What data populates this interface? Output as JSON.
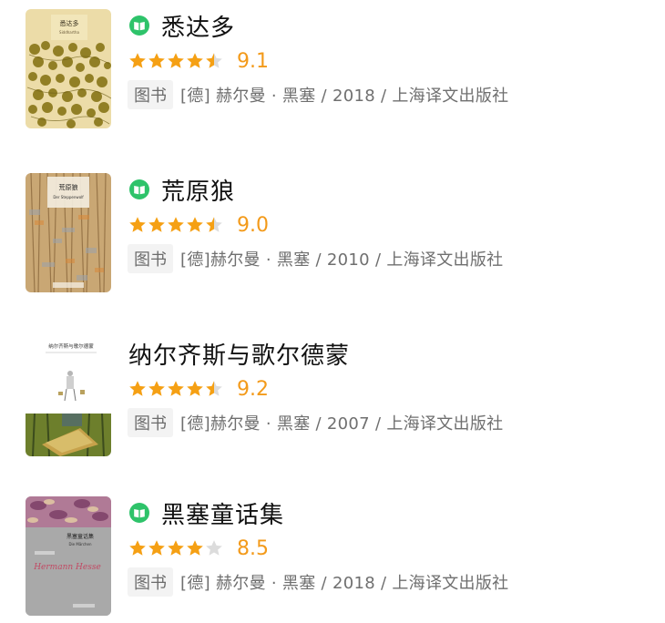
{
  "colors": {
    "star_filled": "#f5a014",
    "star_empty": "#dcdcdc",
    "score": "#f39a1a",
    "ebook_green": "#2ec36a",
    "title": "#111111",
    "meta": "#6f6f6f"
  },
  "books": [
    {
      "title": "悉达多",
      "has_ebook": true,
      "rating_stars": 4.5,
      "score": "9.1",
      "tag": "图书",
      "meta": "[德] 赫尔曼 · 黑塞 / 2018 / 上海译文出版社",
      "cover": {
        "title": "悉达多",
        "subtitle": "Siddhartha"
      }
    },
    {
      "title": "荒原狼",
      "has_ebook": true,
      "rating_stars": 4.5,
      "score": "9.0",
      "tag": "图书",
      "meta": "[德]赫尔曼 · 黑塞 / 2010 / 上海译文出版社",
      "cover": {
        "title": "荒原狼",
        "subtitle": "Der Steppenwolf"
      }
    },
    {
      "title": "纳尔齐斯与歌尔德蒙",
      "has_ebook": false,
      "rating_stars": 4.5,
      "score": "9.2",
      "tag": "图书",
      "meta": "[德]赫尔曼 · 黑塞 / 2007 / 上海译文出版社",
      "cover": {
        "title": "纳尔齐斯与歌尔德蒙"
      }
    },
    {
      "title": "黑塞童话集",
      "has_ebook": true,
      "rating_stars": 4.0,
      "score": "8.5",
      "tag": "图书",
      "meta": "[德] 赫尔曼 · 黑塞 / 2018 / 上海译文出版社",
      "cover": {
        "title": "黑塞童话集",
        "subtitle": "Die Märchen",
        "signature": "Hermann Hesse"
      }
    }
  ]
}
